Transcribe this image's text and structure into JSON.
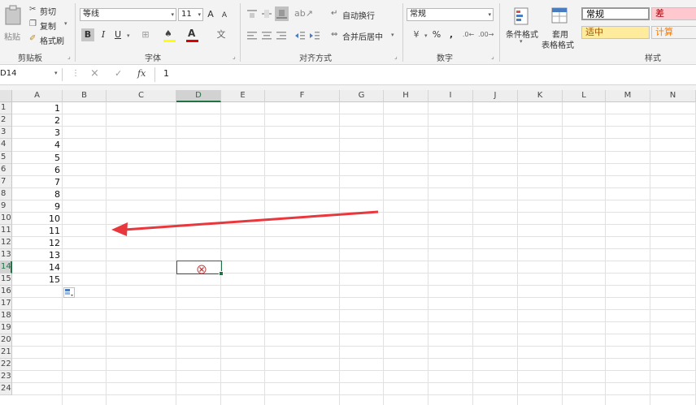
{
  "clipboard": {
    "paste_label": "粘贴",
    "cut_label": "剪切",
    "copy_label": "复制",
    "format_painter_label": "格式刷",
    "group_label": "剪贴板"
  },
  "font": {
    "name": "等线",
    "size": "11",
    "bold": "B",
    "italic": "I",
    "underline": "U",
    "group_label": "字体",
    "grow_glyph": "A",
    "shrink_glyph": "A"
  },
  "alignment": {
    "wrap_label": "自动换行",
    "merge_label": "合并后居中",
    "group_label": "对齐方式"
  },
  "number": {
    "format": "常规",
    "currency_glyph": "¥",
    "percent_glyph": "%",
    "comma_glyph": ",",
    "group_label": "数字"
  },
  "styles": {
    "conditional_label": "条件格式",
    "table_label_1": "套用",
    "table_label_2": "表格格式",
    "group_label": "样式",
    "cells": [
      {
        "label": "常规",
        "bg": "#ffffff",
        "color": "#000000"
      },
      {
        "label": "差",
        "bg": "#ffc7ce",
        "color": "#9c0006"
      },
      {
        "label": "适中",
        "bg": "#ffeb9c",
        "color": "#9c5700"
      },
      {
        "label": "计算",
        "bg": "#f2f2f2",
        "color": "#fa7d00"
      }
    ]
  },
  "formula_bar": {
    "name_box": "D14",
    "cancel_icon": "×",
    "enter_icon": "✓",
    "fx_label": "fx",
    "content": "1"
  },
  "sheet": {
    "columns": [
      "A",
      "B",
      "C",
      "D",
      "E",
      "F",
      "G",
      "H",
      "I",
      "J",
      "K",
      "L",
      "M",
      "N"
    ],
    "selected_column": "D",
    "rows": [
      "1",
      "2",
      "3",
      "4",
      "5",
      "6",
      "7",
      "8",
      "9",
      "10",
      "11",
      "12",
      "13",
      "14",
      "15",
      "16",
      "17",
      "18",
      "19",
      "20",
      "21",
      "22",
      "23",
      "24"
    ],
    "selected_row": "14",
    "column_a_values": [
      1,
      2,
      3,
      4,
      5,
      6,
      7,
      8,
      9,
      10,
      11,
      12,
      13,
      14,
      15
    ],
    "active_cell": "D14"
  },
  "annotation": {
    "arrow_color": "#e8383d"
  },
  "theme": {
    "accent": "#217346"
  }
}
